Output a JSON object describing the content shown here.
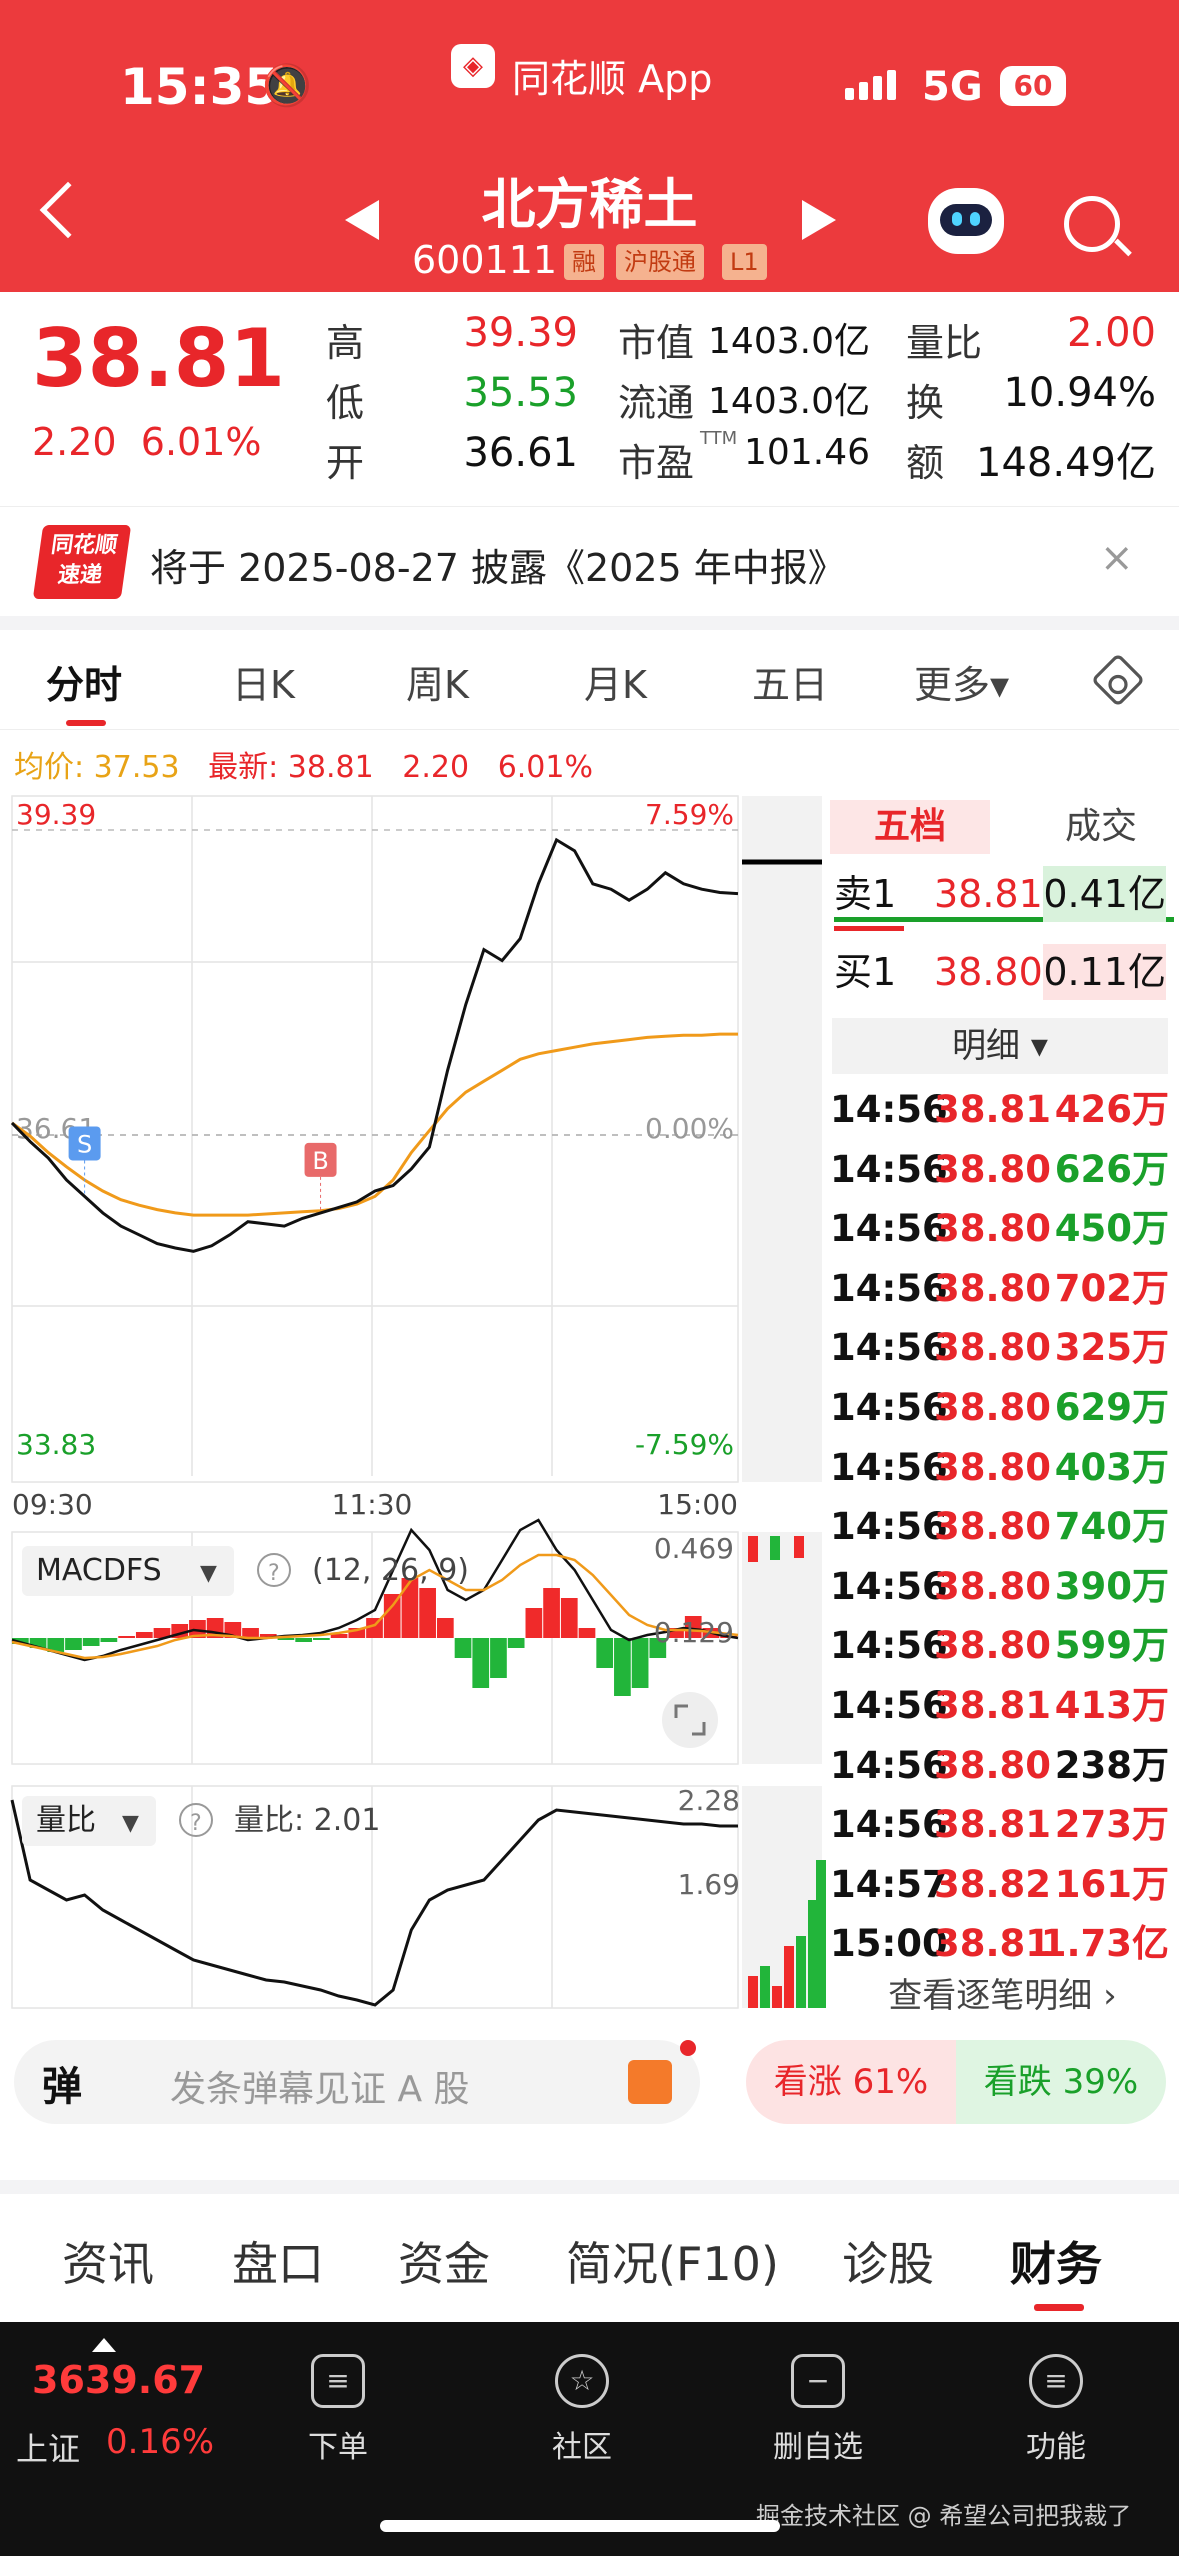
{
  "status": {
    "time": "15:35",
    "app": "同花顺 App",
    "network": "5G",
    "battery": "60"
  },
  "header": {
    "name": "北方稀土",
    "code": "600111",
    "tags": [
      "融",
      "沪股通",
      "L1"
    ]
  },
  "quote": {
    "price": "38.81",
    "change": "2.20",
    "change_pct": "6.01%",
    "labels": {
      "high": "高",
      "low": "低",
      "open": "开",
      "mcap": "市值",
      "float": "流通",
      "pe": "市盈",
      "pe_sup": "TTM",
      "vol_ratio": "量比",
      "turnover": "换",
      "amount": "额"
    },
    "values": {
      "high": "39.39",
      "low": "35.53",
      "open": "36.61",
      "mcap": "1403.0亿",
      "float": "1403.0亿",
      "pe": "101.46",
      "vol_ratio": "2.00",
      "turnover": "10.94%",
      "amount": "148.49亿"
    }
  },
  "notice": {
    "logo_top": "同花顺",
    "logo_bottom": "速递",
    "text": "将于 2025-08-27 披露《2025 年中报》",
    "close": "×"
  },
  "tabs": [
    "分时",
    "日K",
    "周K",
    "月K",
    "五日",
    "更多▾"
  ],
  "avg_line": {
    "avg_label": "均价: 37.53",
    "latest_label": "最新: 38.81",
    "change": "2.20",
    "pct": "6.01%"
  },
  "chart_data": {
    "type": "line",
    "title": "",
    "ylim": [
      33.83,
      39.39
    ],
    "x_ticks": [
      "09:30",
      "11:30",
      "15:00"
    ],
    "y_labels": {
      "top": "39.39",
      "mid": "36.61",
      "bottom": "33.83",
      "top_pct": "7.59%",
      "mid_pct": "0.00%",
      "bottom_pct": "-7.59%"
    },
    "price": [
      36.72,
      36.55,
      36.4,
      36.2,
      36.05,
      35.9,
      35.78,
      35.7,
      35.62,
      35.58,
      35.55,
      35.6,
      35.7,
      35.82,
      35.8,
      35.78,
      35.85,
      35.9,
      35.95,
      36.0,
      36.1,
      36.15,
      36.3,
      36.5,
      37.2,
      37.8,
      38.3,
      38.2,
      38.4,
      38.9,
      39.3,
      39.2,
      38.9,
      38.85,
      38.75,
      38.85,
      39.0,
      38.9,
      38.85,
      38.82,
      38.81
    ],
    "avg": [
      36.72,
      36.6,
      36.45,
      36.32,
      36.2,
      36.1,
      36.02,
      35.97,
      35.93,
      35.9,
      35.88,
      35.88,
      35.88,
      35.88,
      35.89,
      35.9,
      35.91,
      35.92,
      35.94,
      35.98,
      36.05,
      36.2,
      36.45,
      36.65,
      36.85,
      37.0,
      37.1,
      37.2,
      37.3,
      37.35,
      37.38,
      37.41,
      37.44,
      37.46,
      37.48,
      37.5,
      37.51,
      37.52,
      37.52,
      37.53,
      37.53
    ],
    "markers": [
      {
        "label": "S",
        "index": 4
      },
      {
        "label": "B",
        "index": 17
      }
    ]
  },
  "macd": {
    "name": "MACDFS",
    "params": "(12, 26, 9)",
    "v1": "0.469",
    "v2": "0.129"
  },
  "volratio": {
    "name": "量比",
    "label": "量比: 2.01",
    "v1": "2.28",
    "v2": "1.69"
  },
  "book": {
    "tab1": "五档",
    "tab2": "成交",
    "sell1": {
      "label": "卖1",
      "price": "38.81",
      "vol": "0.41亿"
    },
    "buy1": {
      "label": "买1",
      "price": "38.80",
      "vol": "0.11亿"
    },
    "detail": "明细 ▾",
    "more": "查看逐笔明细 ›",
    "trades": [
      {
        "t": "14:56",
        "p": "38.81",
        "v": "426万",
        "c": "red"
      },
      {
        "t": "14:56",
        "p": "38.80",
        "v": "626万",
        "c": "green"
      },
      {
        "t": "14:56",
        "p": "38.80",
        "v": "450万",
        "c": "green"
      },
      {
        "t": "14:56",
        "p": "38.80",
        "v": "702万",
        "c": "red"
      },
      {
        "t": "14:56",
        "p": "38.80",
        "v": "325万",
        "c": "red"
      },
      {
        "t": "14:56",
        "p": "38.80",
        "v": "629万",
        "c": "green"
      },
      {
        "t": "14:56",
        "p": "38.80",
        "v": "403万",
        "c": "green"
      },
      {
        "t": "14:56",
        "p": "38.80",
        "v": "740万",
        "c": "green"
      },
      {
        "t": "14:56",
        "p": "38.80",
        "v": "390万",
        "c": "green"
      },
      {
        "t": "14:56",
        "p": "38.80",
        "v": "599万",
        "c": "green"
      },
      {
        "t": "14:56",
        "p": "38.81",
        "v": "413万",
        "c": "red"
      },
      {
        "t": "14:56",
        "p": "38.80",
        "v": "238万",
        "c": "black"
      },
      {
        "t": "14:56",
        "p": "38.81",
        "v": "273万",
        "c": "red"
      },
      {
        "t": "14:57",
        "p": "38.82",
        "v": "161万",
        "c": "red"
      },
      {
        "t": "15:00",
        "p": "38.81",
        "v": "1.73亿",
        "c": "red"
      }
    ]
  },
  "danmu": {
    "icon": "弹",
    "placeholder": "发条弹幕见证 A 股"
  },
  "sentiment": {
    "up": "看涨 61%",
    "down": "看跌 39%"
  },
  "bottom_tabs": [
    "资讯",
    "盘口",
    "资金",
    "简况(F10)",
    "诊股",
    "财务"
  ],
  "bottom_bar": {
    "index": "3639.67",
    "index_name": "上证",
    "index_pct": "0.16%",
    "items": [
      "下单",
      "社区",
      "删自选",
      "功能"
    ],
    "watermark": "掘金技术社区 @ 希望公司把我裁了"
  }
}
